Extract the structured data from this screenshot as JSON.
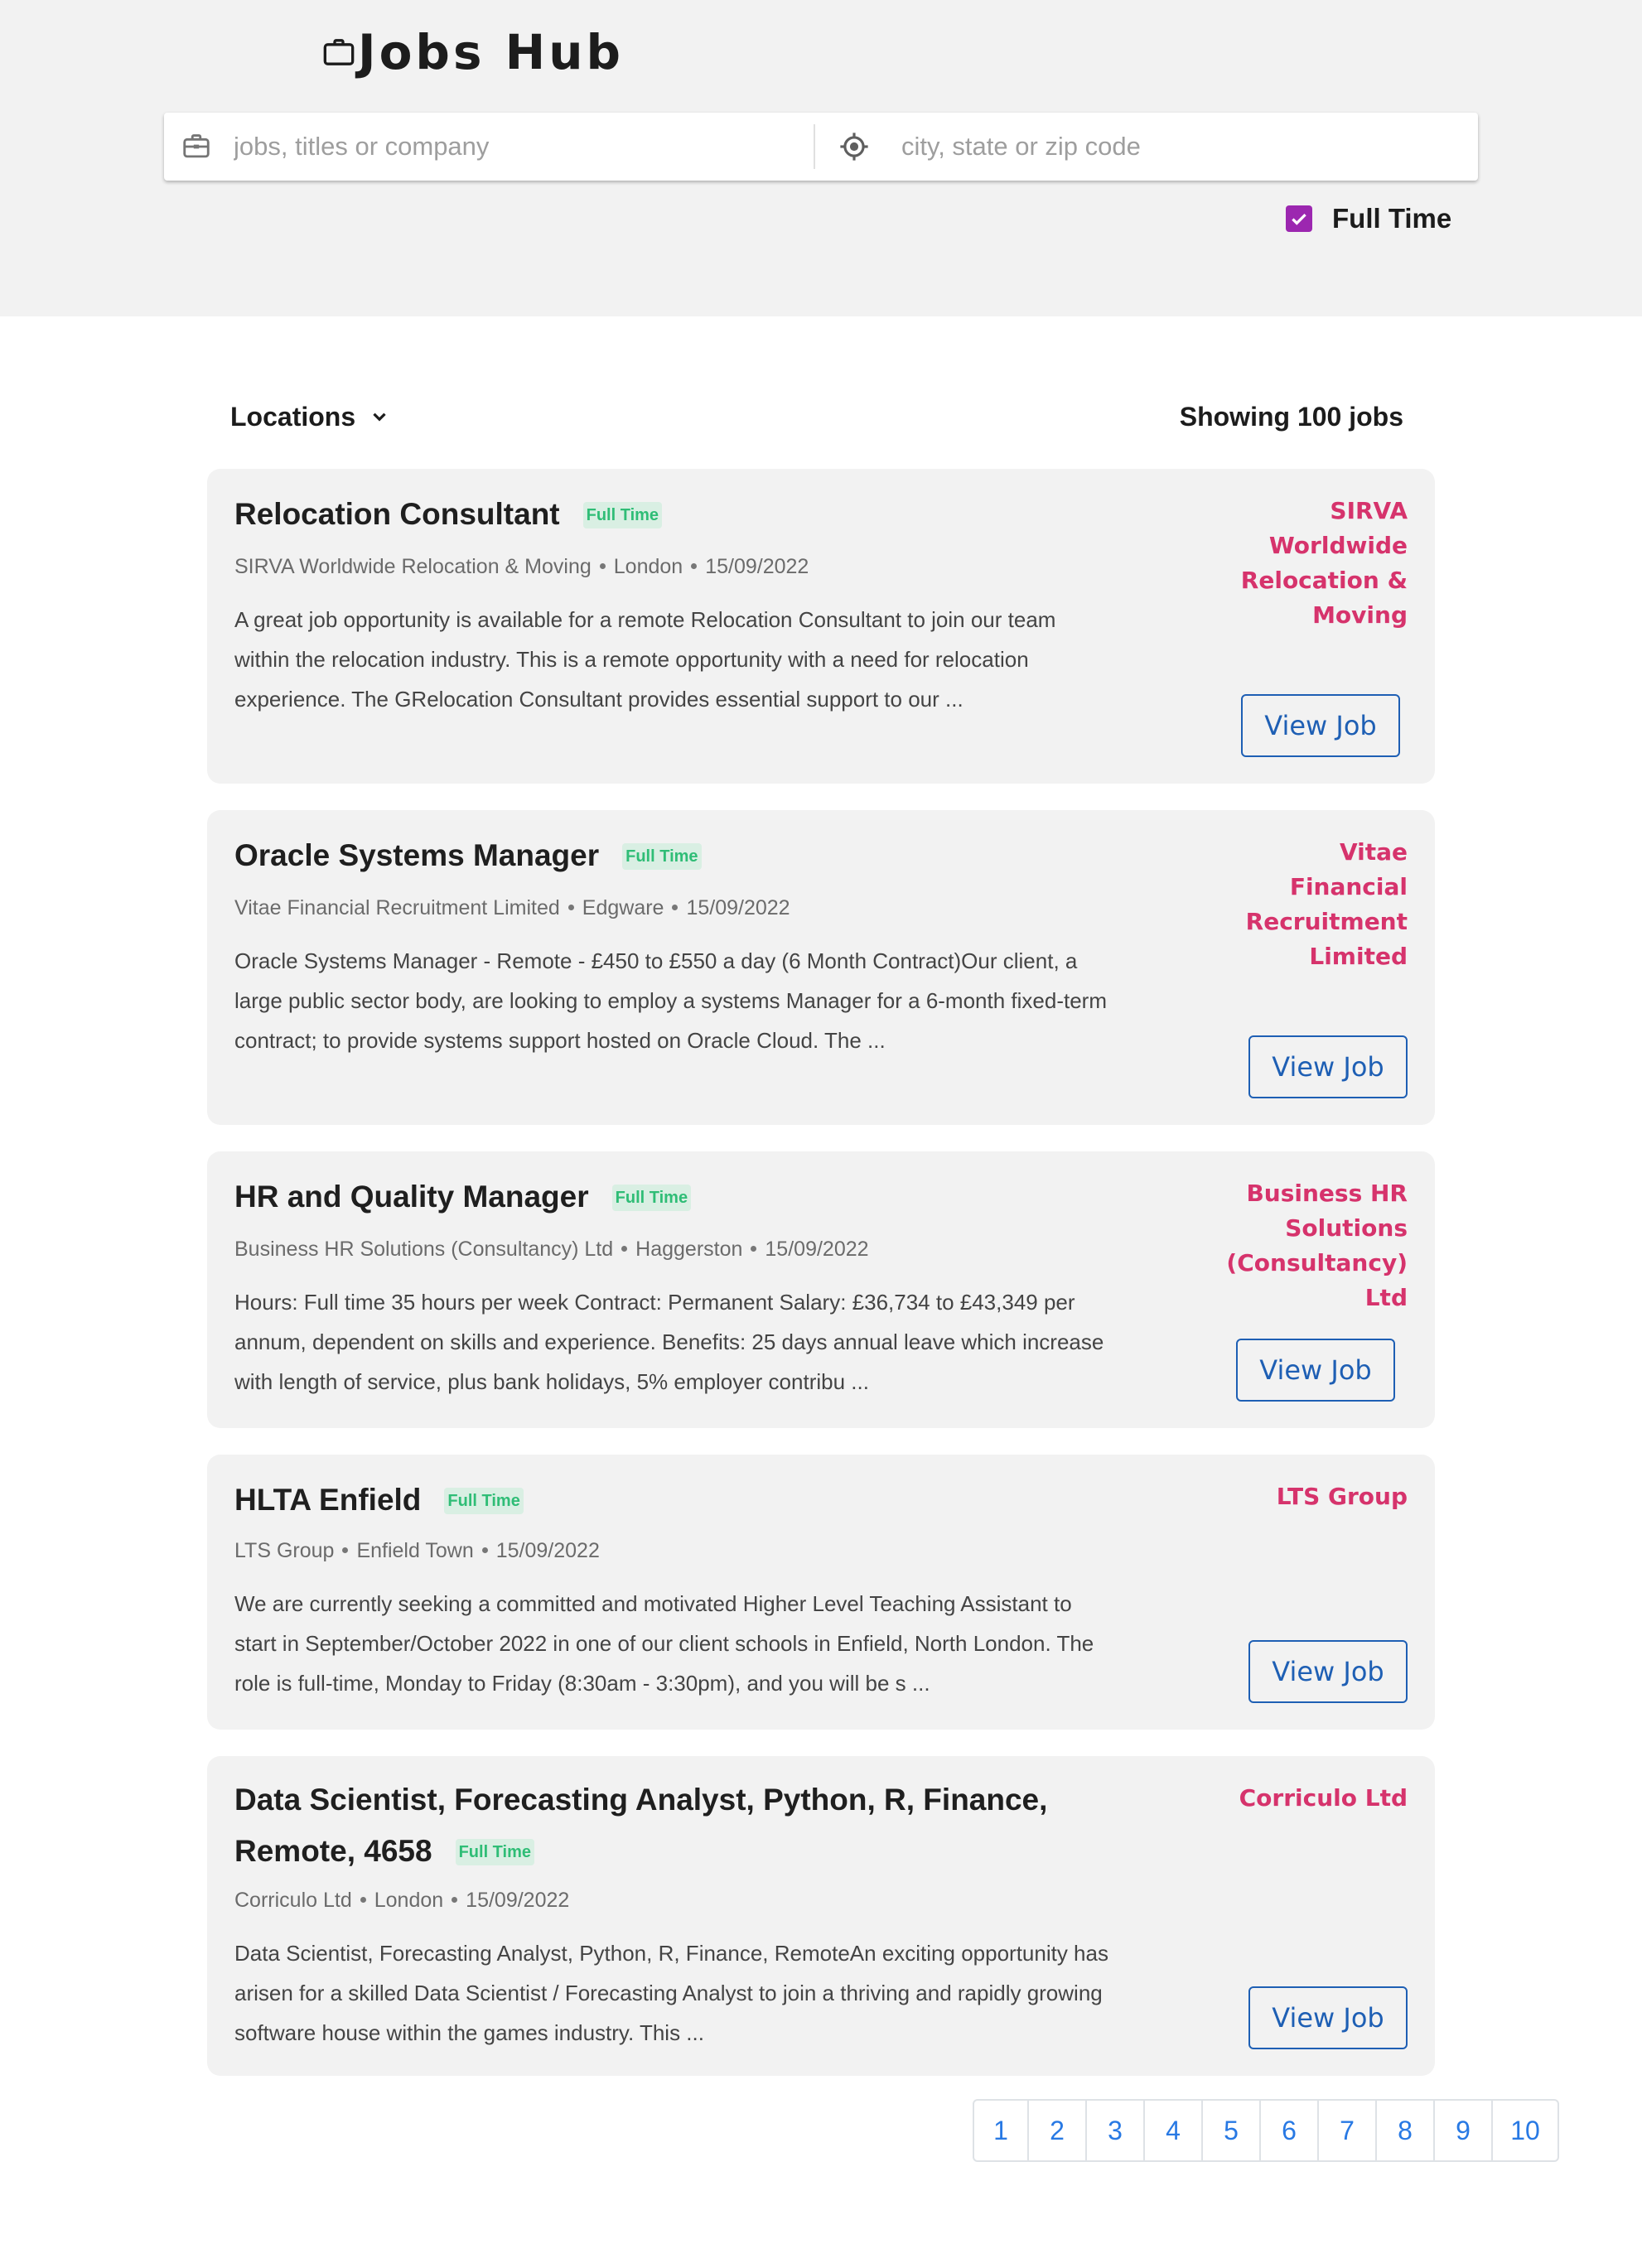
{
  "header": {
    "brand": "Jobs Hub",
    "brand_icon": "briefcase-icon",
    "search_placeholder": "jobs, titles or company",
    "location_placeholder": "city, state or zip code",
    "full_time_label": "Full Time",
    "full_time_checked": true,
    "accent_color": "#9c27b0"
  },
  "toolbar": {
    "locations_label": "Locations",
    "job_count": "Showing 100 jobs"
  },
  "jobs": [
    {
      "title": "Relocation Consultant",
      "badge": "Full Time",
      "company": "SIRVA Worldwide Relocation & Moving",
      "location": "London",
      "date": "15/09/2022",
      "description": "A great job opportunity is available for a remote Relocation Consultant to join our team within the relocation industry. This is a remote opportunity with a need for relocation experience. The GRelocation Consultant provides essential support to our ...",
      "company_label": "SIRVA Worldwide Relocation & Moving",
      "button": "View Job"
    },
    {
      "title": "Oracle Systems Manager",
      "badge": "Full Time",
      "company": "Vitae Financial Recruitment Limited",
      "location": "Edgware",
      "date": "15/09/2022",
      "description": "Oracle Systems Manager - Remote - £450 to £550 a day (6 Month Contract)Our client, a large public sector body, are looking to employ a systems Manager for a 6-month fixed-term contract; to provide systems support hosted on Oracle Cloud. The ...",
      "company_label": "Vitae Financial Recruitment Limited",
      "button": "View Job"
    },
    {
      "title": "HR and Quality Manager",
      "badge": "Full Time",
      "company": "Business HR Solutions (Consultancy) Ltd",
      "location": "Haggerston",
      "date": "15/09/2022",
      "description": "Hours: Full time 35 hours per week Contract: Permanent Salary: £36,734 to £43,349 per annum, dependent on skills and experience. Benefits: 25 days annual leave which increase with length of service, plus bank holidays, 5% employer contribu ...",
      "company_label": "Business HR Solutions (Consultancy) Ltd",
      "button": "View Job"
    },
    {
      "title": "HLTA Enfield",
      "badge": "Full Time",
      "company": "LTS Group",
      "location": "Enfield Town",
      "date": "15/09/2022",
      "description": "We are currently seeking a committed and motivated Higher Level Teaching Assistant to start in September/October 2022 in one of our client schools in Enfield, North London. The role is full-time, Monday to Friday (8:30am - 3:30pm), and you will be s ...",
      "company_label": "LTS Group",
      "button": "View Job"
    },
    {
      "title": "Data Scientist, Forecasting Analyst, Python, R, Finance, Remote, 4658",
      "badge": "Full Time",
      "company": "Corriculo Ltd",
      "location": "London",
      "date": "15/09/2022",
      "description": "Data Scientist, Forecasting Analyst, Python, R, Finance, RemoteAn exciting opportunity has arisen for a skilled Data Scientist / Forecasting Analyst to join a thriving and rapidly growing software house within the games industry. This ...",
      "company_label": "Corriculo Ltd",
      "button": "View Job"
    }
  ],
  "pagination": {
    "pages": [
      "1",
      "2",
      "3",
      "4",
      "5",
      "6",
      "7",
      "8",
      "9",
      "10"
    ]
  }
}
